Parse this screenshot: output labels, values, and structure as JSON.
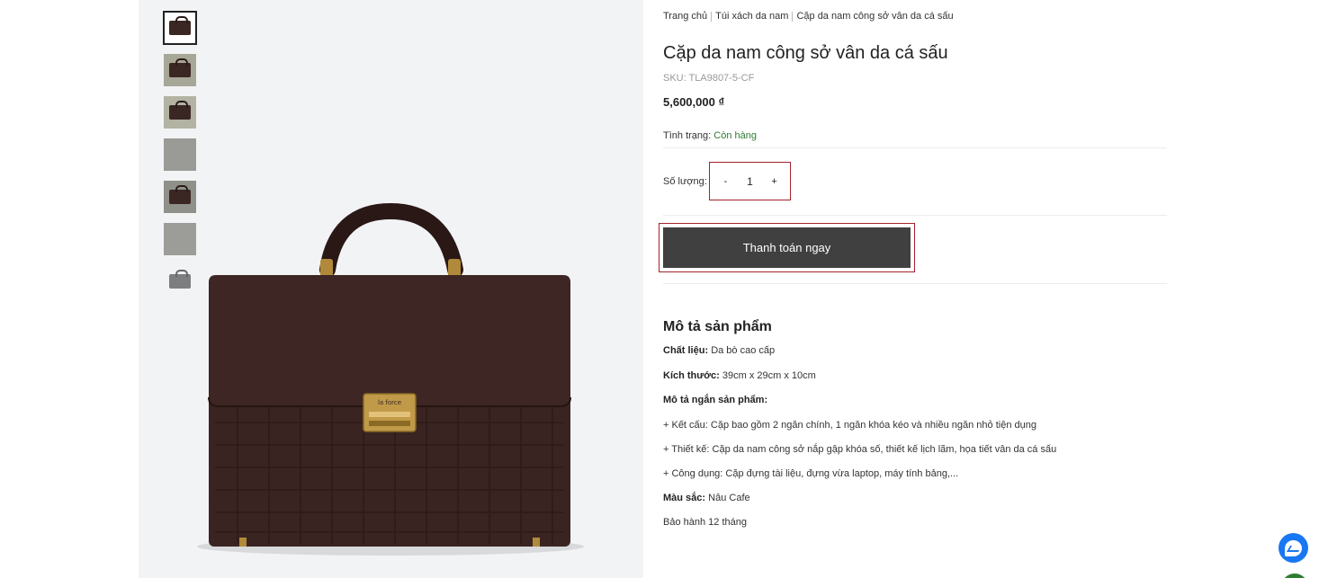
{
  "gallery": {
    "thumbnails": [
      {
        "alt": "thumbnail-1"
      },
      {
        "alt": "thumbnail-2"
      },
      {
        "alt": "thumbnail-3"
      },
      {
        "alt": "thumbnail-4"
      },
      {
        "alt": "thumbnail-5"
      },
      {
        "alt": "thumbnail-6"
      },
      {
        "alt": "thumbnail-7"
      }
    ],
    "brand_plate_text": "la force"
  },
  "breadcrumb": {
    "home": "Trang chủ",
    "category": "Túi xách da nam",
    "current": "Cặp da nam công sở vân da cá sấu"
  },
  "product": {
    "title": "Cặp da nam công sở vân da cá sấu",
    "sku": "SKU: TLA9807-5-CF",
    "price": "5,600,000 ₫",
    "status_label": "Tình trạng:",
    "status_value": "Còn hàng",
    "qty_label": "Số lượng:",
    "qty_minus": "-",
    "qty_value": "1",
    "qty_plus": "+",
    "buy_button": "Thanh toán ngay"
  },
  "description": {
    "title": "Mô tả sản phẩm",
    "material_label": "Chất liệu:",
    "material_value": "Da bò cao cấp",
    "size_label": "Kích thước:",
    "size_value": "39cm x 29cm x 10cm",
    "short_label": "Mô tả ngắn sản phẩm:",
    "line_structure": "+ Kết cấu: Cặp bao gồm 2 ngăn chính, 1 ngăn khóa kéo và nhiều ngăn nhỏ tiện dụng",
    "line_design": "+ Thiết kế: Cặp da nam công sở nắp gập khóa số, thiết kế lịch lãm, họa tiết vân da cá sấu",
    "line_usage": "+ Công dụng: Cặp đựng tài liệu, đựng vừa laptop, máy tính bảng,...",
    "color_label": "Màu sắc:",
    "color_value": "Nâu Cafe",
    "warranty": "Bảo hành 12 tháng"
  },
  "colors": {
    "accent_red": "#a3222b",
    "button_dark": "#404040",
    "status_green": "#2e7d32",
    "messenger_blue": "#1877f2"
  }
}
